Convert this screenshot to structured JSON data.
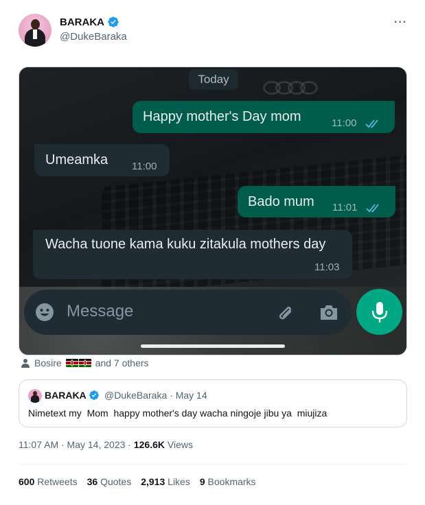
{
  "author": {
    "name": "BARAKA",
    "handle": "@DukeBaraka",
    "verified_icon": "verified-badge-icon",
    "more_label": "···"
  },
  "media": {
    "day_label": "Today",
    "messages": [
      {
        "direction": "outgoing",
        "text": "Happy mother's Day mom",
        "time": "11:00",
        "read": true
      },
      {
        "direction": "incoming",
        "text": "Umeamka",
        "time": "11:00"
      },
      {
        "direction": "outgoing",
        "text": "Bado mum",
        "time": "11:01",
        "read": true
      },
      {
        "direction": "incoming",
        "text": "Wacha tuone kama kuku zitakula mothers day",
        "time": "11:03"
      }
    ],
    "composer_placeholder": "Message",
    "colors": {
      "outgoing_bubble": "#005c4b",
      "incoming_bubble": "#202c33",
      "mic_button": "#00a884",
      "read_ticks": "#53bdeb"
    }
  },
  "tagged": {
    "first": "Bosire",
    "rest": "and 7 others"
  },
  "quote": {
    "name": "BARAKA",
    "handle_date": "@DukeBaraka · May 14",
    "text": "Nimetext my  Mom  happy mother's day wacha ningoje jibu ya  miujiza"
  },
  "meta": {
    "time_date": "11:07 AM · May 14, 2023 · ",
    "views_count": "126.6K",
    "views_label": " Views"
  },
  "stats": {
    "retweets_count": "600",
    "retweets_label": " Retweets",
    "quotes_count": "36",
    "quotes_label": " Quotes",
    "likes_count": "2,913",
    "likes_label": " Likes",
    "bookmarks_count": "9",
    "bookmarks_label": " Bookmarks"
  }
}
